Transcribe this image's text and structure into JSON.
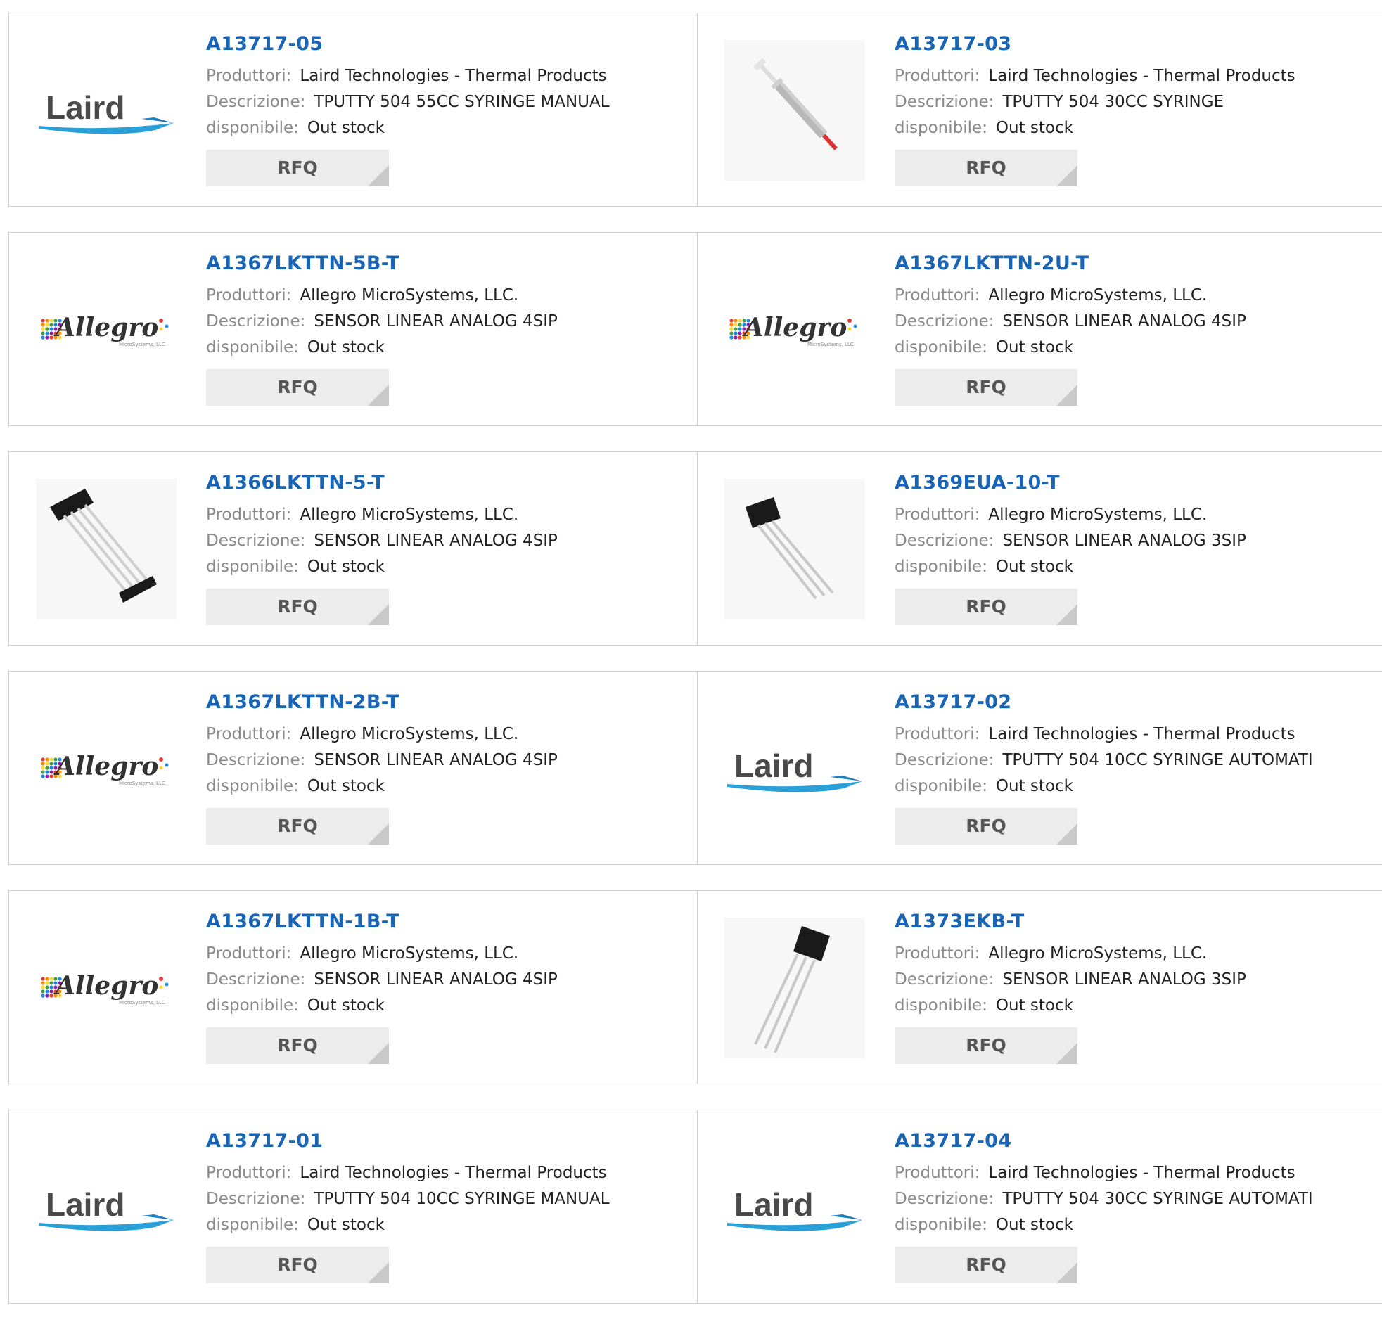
{
  "labels": {
    "manufacturer": "Produttori:",
    "description": "Descrizione:",
    "availability": "disponibile:",
    "rfq": "RFQ"
  },
  "products": [
    {
      "part": "A13717-05",
      "manufacturer": "Laird Technologies - Thermal Products",
      "description": "TPUTTY 504 55CC SYRINGE MANUAL",
      "availability": "Out stock",
      "image": "laird-logo"
    },
    {
      "part": "A13717-03",
      "manufacturer": "Laird Technologies - Thermal Products",
      "description": "TPUTTY 504 30CC SYRINGE",
      "availability": "Out stock",
      "image": "syringe-photo"
    },
    {
      "part": "A1367LKTTN-5B-T",
      "manufacturer": "Allegro MicroSystems, LLC.",
      "description": "SENSOR LINEAR ANALOG 4SIP",
      "availability": "Out stock",
      "image": "allegro-logo"
    },
    {
      "part": "A1367LKTTN-2U-T",
      "manufacturer": "Allegro MicroSystems, LLC.",
      "description": "SENSOR LINEAR ANALOG 4SIP",
      "availability": "Out stock",
      "image": "allegro-logo"
    },
    {
      "part": "A1366LKTTN-5-T",
      "manufacturer": "Allegro MicroSystems, LLC.",
      "description": "SENSOR LINEAR ANALOG 4SIP",
      "availability": "Out stock",
      "image": "sip4-photo"
    },
    {
      "part": "A1369EUA-10-T",
      "manufacturer": "Allegro MicroSystems, LLC.",
      "description": "SENSOR LINEAR ANALOG 3SIP",
      "availability": "Out stock",
      "image": "sip3-photo"
    },
    {
      "part": "A1367LKTTN-2B-T",
      "manufacturer": "Allegro MicroSystems, LLC.",
      "description": "SENSOR LINEAR ANALOG 4SIP",
      "availability": "Out stock",
      "image": "allegro-logo"
    },
    {
      "part": "A13717-02",
      "manufacturer": "Laird Technologies - Thermal Products",
      "description": "TPUTTY 504 10CC SYRINGE AUTOMATI",
      "availability": "Out stock",
      "image": "laird-logo"
    },
    {
      "part": "A1367LKTTN-1B-T",
      "manufacturer": "Allegro MicroSystems, LLC.",
      "description": "SENSOR LINEAR ANALOG 4SIP",
      "availability": "Out stock",
      "image": "allegro-logo"
    },
    {
      "part": "A1373EKB-T",
      "manufacturer": "Allegro MicroSystems, LLC.",
      "description": "SENSOR LINEAR ANALOG 3SIP",
      "availability": "Out stock",
      "image": "sip3-photo-angled"
    },
    {
      "part": "A13717-01",
      "manufacturer": "Laird Technologies - Thermal Products",
      "description": "TPUTTY 504 10CC SYRINGE MANUAL",
      "availability": "Out stock",
      "image": "laird-logo"
    },
    {
      "part": "A13717-04",
      "manufacturer": "Laird Technologies - Thermal Products",
      "description": "TPUTTY 504 30CC SYRINGE AUTOMATI",
      "availability": "Out stock",
      "image": "laird-logo"
    }
  ],
  "logos": {
    "laird": "Laird",
    "allegro": "Allegro",
    "allegro_sub": "MicroSystems, LLC"
  },
  "colors": {
    "part_link": "#1a64b4",
    "label": "#8a8a8a",
    "rfq_bg": "#ececec",
    "border": "#cfcfcf"
  }
}
